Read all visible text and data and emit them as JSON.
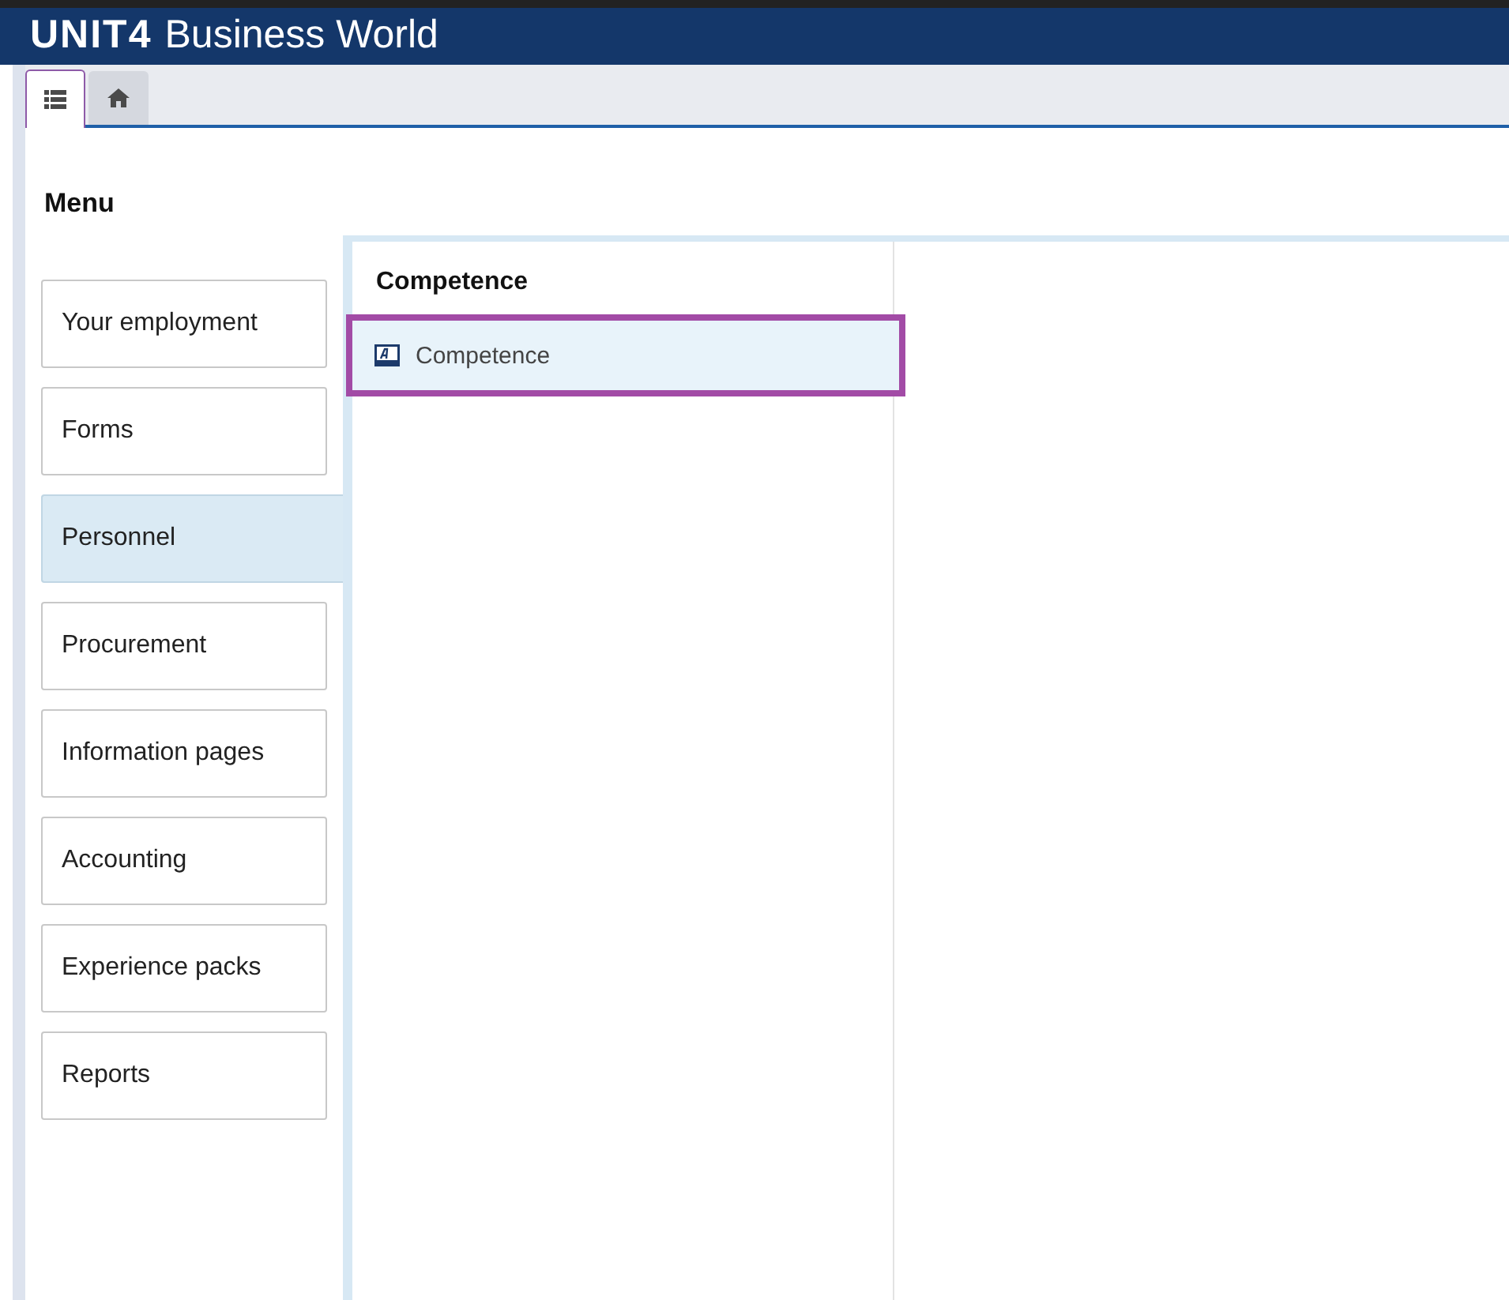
{
  "header": {
    "logo": "UNIT4",
    "title": "Business World"
  },
  "tabs": [
    {
      "kind": "menu",
      "selected": true
    },
    {
      "kind": "home",
      "selected": false
    }
  ],
  "menu": {
    "title": "Menu",
    "items": [
      {
        "label": "Your employment",
        "selected": false
      },
      {
        "label": "Forms",
        "selected": false
      },
      {
        "label": "Personnel",
        "selected": true
      },
      {
        "label": "Procurement",
        "selected": false
      },
      {
        "label": "Information pages",
        "selected": false
      },
      {
        "label": "Accounting",
        "selected": false
      },
      {
        "label": "Experience packs",
        "selected": false
      },
      {
        "label": "Reports",
        "selected": false
      }
    ]
  },
  "panel": {
    "heading": "Competence",
    "items": [
      {
        "label": "Competence",
        "selected": true
      }
    ]
  }
}
